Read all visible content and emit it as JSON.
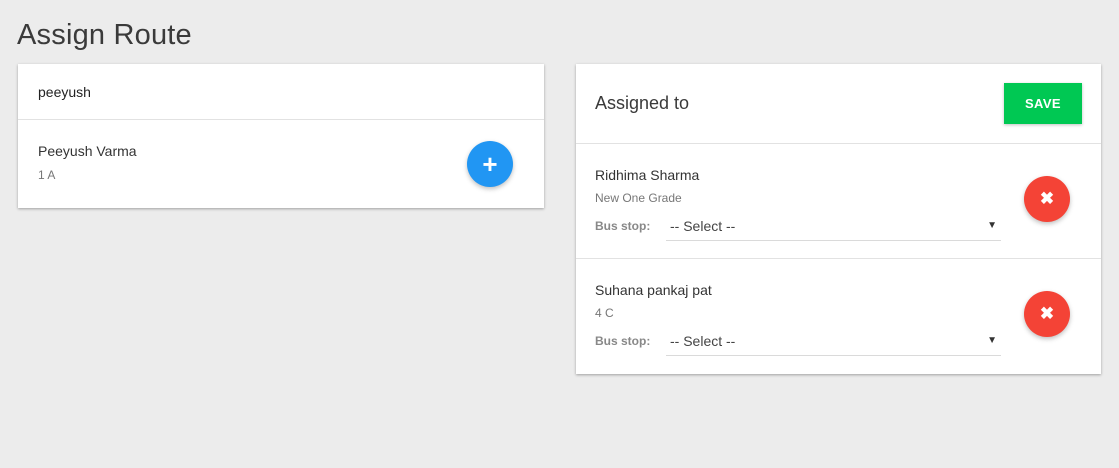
{
  "page": {
    "title": "Assign Route"
  },
  "search": {
    "value": "peeyush"
  },
  "results": [
    {
      "name": "Peeyush Varma",
      "class": "1 A",
      "action_icon": "plus-icon",
      "action_glyph": "+"
    }
  ],
  "assigned": {
    "title": "Assigned to",
    "save_label": "SAVE",
    "items": [
      {
        "name": "Ridhima Sharma",
        "class": "New One Grade",
        "bus_stop_label": "Bus stop:",
        "bus_stop_value": "-- Select --",
        "remove_glyph": "✖"
      },
      {
        "name": "Suhana pankaj pat",
        "class": "4 C",
        "bus_stop_label": "Bus stop:",
        "bus_stop_value": "-- Select --",
        "remove_glyph": "✖"
      }
    ]
  },
  "colors": {
    "add": "#2196f3",
    "remove": "#f44336",
    "save": "#00c853"
  }
}
